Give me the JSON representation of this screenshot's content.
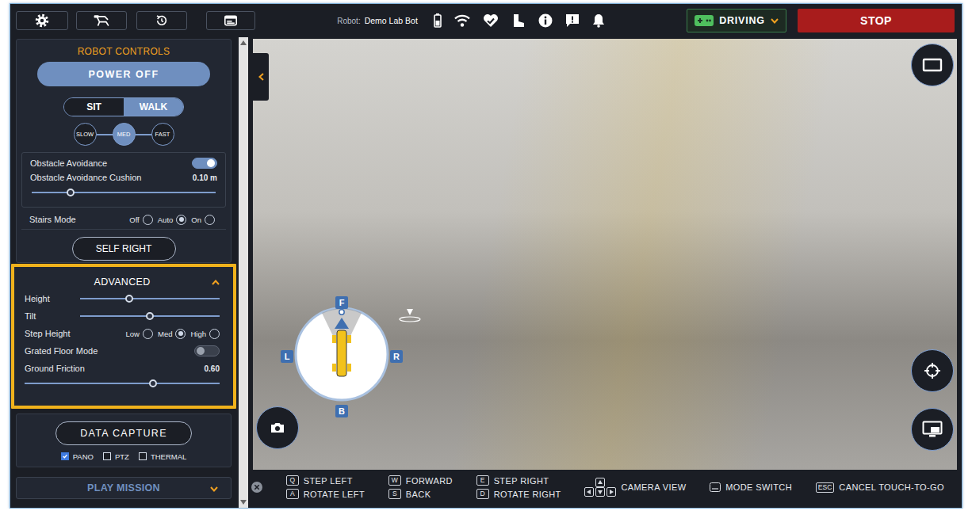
{
  "top_bar": {
    "robot_label": "Robot:",
    "robot_name": "Demo Lab Bot",
    "mode": "DRIVING",
    "stop": "STOP"
  },
  "controls": {
    "title": "ROBOT CONTROLS",
    "power": "POWER OFF",
    "posture": [
      {
        "label": "SIT",
        "selected": false
      },
      {
        "label": "WALK",
        "selected": true
      }
    ],
    "speed": [
      {
        "label": "SLOW",
        "selected": false
      },
      {
        "label": "MED",
        "selected": true
      },
      {
        "label": "FAST",
        "selected": false
      }
    ],
    "obstacle_avoidance": {
      "label": "Obstacle Avoidance",
      "on": true
    },
    "cushion": {
      "label": "Obstacle Avoidance Cushion",
      "reading": "0.10 m",
      "level": 0.21
    },
    "stairs_mode": {
      "label": "Stairs Mode",
      "options": [
        {
          "label": "Off",
          "selected": false
        },
        {
          "label": "Auto",
          "selected": true
        },
        {
          "label": "On",
          "selected": false
        }
      ]
    },
    "self_right": "SELF RIGHT"
  },
  "advanced": {
    "title": "ADVANCED",
    "expanded": true,
    "highlighted": true,
    "rows": [
      {
        "kind": "slider",
        "label": "Height",
        "level": 0.35
      },
      {
        "kind": "slider",
        "label": "Tilt",
        "level": 0.5
      },
      {
        "kind": "radio",
        "label": "Step Height",
        "options": [
          {
            "label": "Low",
            "selected": false
          },
          {
            "label": "Med",
            "selected": true
          },
          {
            "label": "High",
            "selected": false
          }
        ]
      },
      {
        "kind": "toggle",
        "label": "Grated Floor Mode",
        "on": false
      },
      {
        "kind": "wide-slider",
        "label": "Ground Friction",
        "reading": "0.60",
        "level": 0.66
      }
    ]
  },
  "data_capture": {
    "button": "DATA CAPTURE",
    "options": [
      {
        "label": "PANO",
        "checked": true
      },
      {
        "label": "PTZ",
        "checked": false
      },
      {
        "label": "THERMAL",
        "checked": false
      }
    ]
  },
  "play_mission": {
    "label": "PLAY MISSION",
    "expanded": false
  },
  "compass": {
    "front": "F",
    "left": "L",
    "right": "R",
    "back": "B"
  },
  "shortcuts": {
    "columns": [
      [
        {
          "key": "Q",
          "label": "STEP LEFT"
        },
        {
          "key": "A",
          "label": "ROTATE LEFT"
        }
      ],
      [
        {
          "key": "W",
          "label": "FORWARD"
        },
        {
          "key": "S",
          "label": "BACK"
        }
      ],
      [
        {
          "key": "E",
          "label": "STEP RIGHT"
        },
        {
          "key": "D",
          "label": "ROTATE RIGHT"
        }
      ]
    ],
    "camera_view": "CAMERA VIEW",
    "mode_switch": "MODE SWITCH",
    "cancel": {
      "key": "ESC",
      "label": "CANCEL TOUCH-TO-GO"
    }
  }
}
